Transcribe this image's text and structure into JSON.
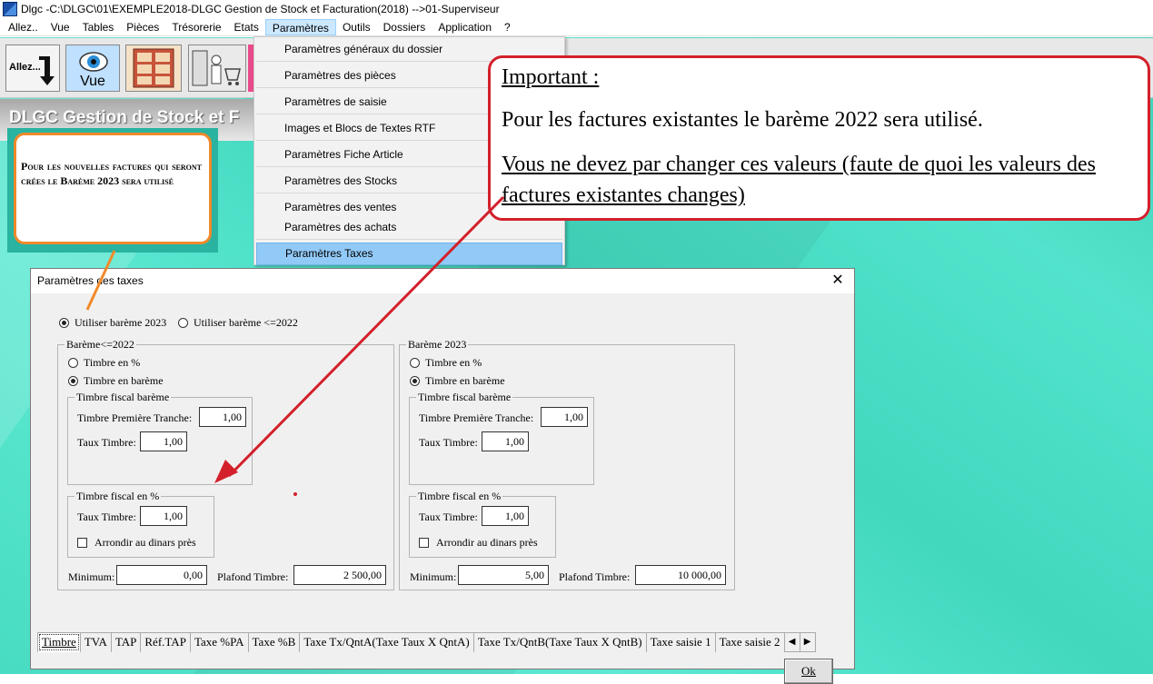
{
  "window": {
    "title": "Dlgc -C:\\DLGC\\01\\EXEMPLE2018-DLGC Gestion de Stock et Facturation(2018) -->01-Superviseur"
  },
  "menubar": {
    "items": [
      "Allez..",
      "Vue",
      "Tables",
      "Pièces",
      "Trésorerie",
      "Etats",
      "Paramètres",
      "Outils",
      "Dossiers",
      "Application",
      "?"
    ],
    "active": "Paramètres"
  },
  "toolbar": {
    "allez_label": "Allez...",
    "vue_label": "Vue"
  },
  "banner": {
    "title": "DLGC Gestion de Stock et F"
  },
  "dropdown": {
    "items": [
      "Paramètres généraux du dossier",
      "Paramètres des pièces",
      "Paramètres de saisie",
      "Images et Blocs de Textes RTF",
      "Paramètres Fiche Article",
      "Paramètres des Stocks",
      "Paramètres des ventes",
      "Paramètres des achats",
      "Paramètres Taxes"
    ],
    "highlighted": "Paramètres Taxes"
  },
  "callout_left": {
    "text": "Pour les nouvelles factures qui seront crées  le Barème 2023 sera utilisé"
  },
  "callout_important": {
    "title": "Important :",
    "line1": "Pour les factures existantes le barème 2022 sera utilisé.",
    "line2": "Vous ne devez par changer ces valeurs (faute de quoi les valeurs des factures existantes  changes)"
  },
  "dialog": {
    "title": "Paramètres des taxes",
    "close": "✕",
    "bareme_choice": {
      "opt2023": "Utiliser barème 2023",
      "opt2022": "Utiliser barème <=2022",
      "selected": "2023"
    },
    "left": {
      "group": "Barème<=2022",
      "timbre_pct": "Timbre en %",
      "timbre_bareme": "Timbre en barème",
      "selected": "bareme",
      "fiscal_bareme_group": "Timbre fiscal barème",
      "premiere_tranche_label": "Timbre Première Tranche:",
      "premiere_tranche_value": "1,00",
      "taux_label": "Taux Timbre:",
      "taux_value": "1,00",
      "fiscal_pct_group": "Timbre fiscal en %",
      "taux_pct_label": "Taux Timbre:",
      "taux_pct_value": "1,00",
      "arrondir": "Arrondir au dinars près",
      "minimum_label": "Minimum:",
      "minimum_value": "0,00",
      "plafond_label": "Plafond Timbre:",
      "plafond_value": "2 500,00"
    },
    "right": {
      "group": "Barème 2023",
      "timbre_pct": "Timbre en %",
      "timbre_bareme": "Timbre en barème",
      "selected": "bareme",
      "fiscal_bareme_group": "Timbre fiscal barème",
      "premiere_tranche_label": "Timbre Première Tranche:",
      "premiere_tranche_value": "1,00",
      "taux_label": "Taux Timbre:",
      "taux_value": "1,00",
      "fiscal_pct_group": "Timbre fiscal en %",
      "taux_pct_label": "Taux Timbre:",
      "taux_pct_value": "1,00",
      "arrondir": "Arrondir au dinars près",
      "minimum_label": "Minimum:",
      "minimum_value": "5,00",
      "plafond_label": "Plafond Timbre:",
      "plafond_value": "10 000,00"
    },
    "tabs": [
      "Timbre",
      "TVA",
      "TAP",
      "Réf.TAP",
      "Taxe %PA",
      "Taxe %B",
      "Taxe Tx/QntA(Taxe Taux X QntA)",
      "Taxe Tx/QntB(Taxe Taux X QntB)",
      "Taxe saisie 1",
      "Taxe saisie 2"
    ],
    "active_tab": "Timbre",
    "tab_prev": "◀",
    "tab_next": "▶",
    "ok_label": "Ok"
  },
  "colors": {
    "callout_red": "#d3202a",
    "callout_orange": "#f08a2a",
    "menu_highlight": "#91c9f7",
    "workspace_teal": "#48dcc2"
  }
}
